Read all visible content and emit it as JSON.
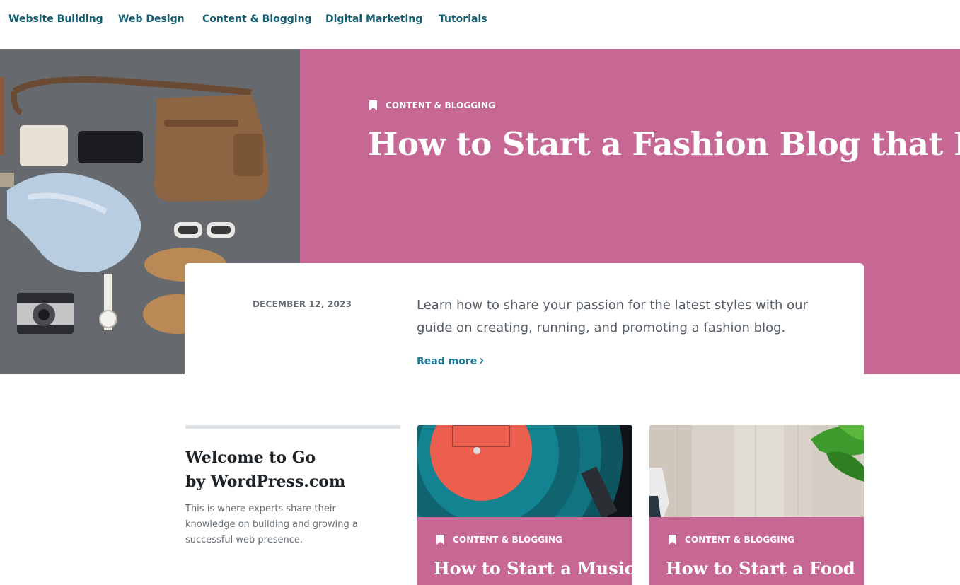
{
  "nav": {
    "items": [
      {
        "label": "Website Building"
      },
      {
        "label": "Web Design"
      },
      {
        "label": "Content & Blogging"
      },
      {
        "label": "Digital Marketing"
      },
      {
        "label": "Tutorials"
      }
    ]
  },
  "hero": {
    "category": "CONTENT & BLOGGING",
    "title": "How to Start a Fashion Blog that Ignites",
    "background_color": "#c76894",
    "image_icon": "fashion-flatlay-image"
  },
  "card": {
    "date": "DECEMBER 12, 2023",
    "excerpt": "Learn how to share your passion for the latest styles with our guide on creating, running, and promoting a fashion blog.",
    "read_more": "Read more",
    "read_more_icon": "chevron-right-icon"
  },
  "welcome": {
    "title_line1": "Welcome to Go",
    "title_line2": "by WordPress.com",
    "text": "This is where experts share their knowledge on building and growing a successful web presence."
  },
  "posts": [
    {
      "category": "CONTENT & BLOGGING",
      "title": "How to Start a Music",
      "image_icon": "vinyl-record-image"
    },
    {
      "category": "CONTENT & BLOGGING",
      "title": "How to Start a Food",
      "image_icon": "cutting-board-image"
    }
  ],
  "colors": {
    "accent": "#c76894",
    "nav_text": "#145d70",
    "link": "#1a7a99"
  }
}
